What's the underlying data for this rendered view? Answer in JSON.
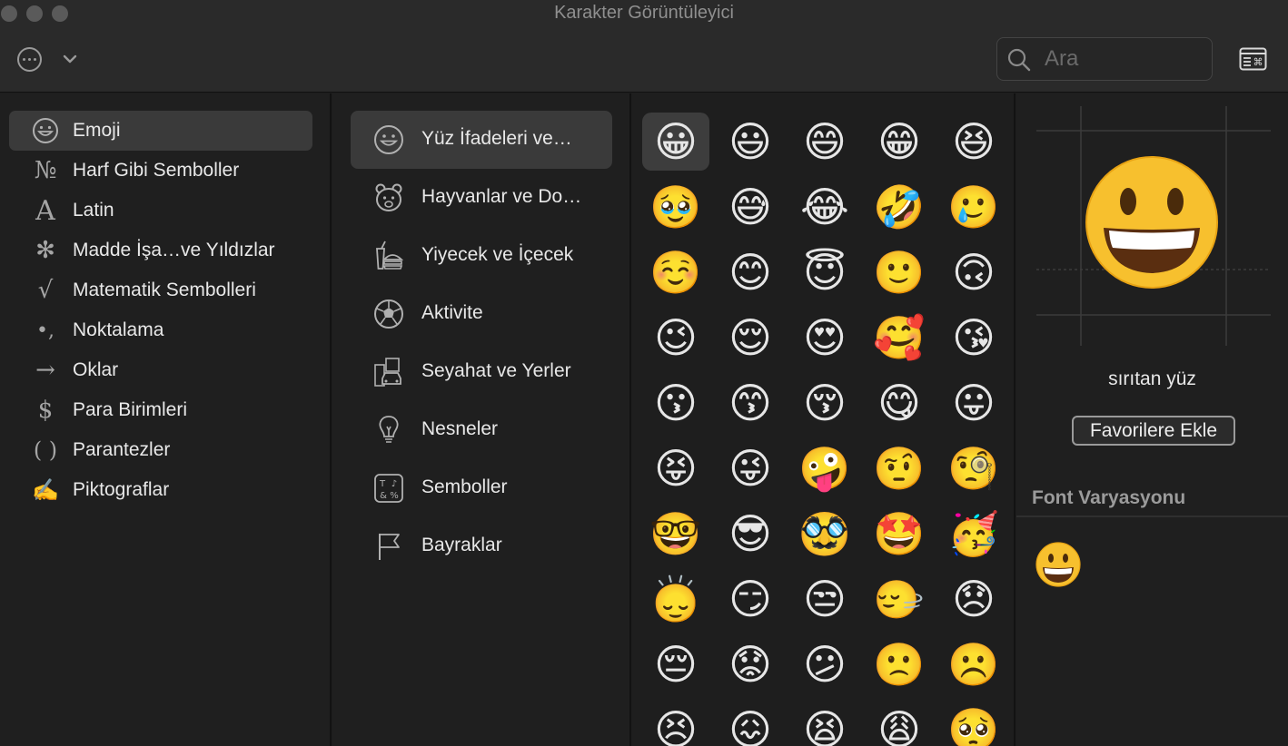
{
  "window": {
    "title": "Karakter Görüntüleyici"
  },
  "toolbar": {
    "search_placeholder": "Ara"
  },
  "categories": [
    {
      "label": "Emoji",
      "icon": "☺"
    },
    {
      "label": "Harf Gibi Semboller",
      "icon": "№"
    },
    {
      "label": "Latin",
      "icon": "A"
    },
    {
      "label": "Madde İşa…ve Yıldızlar",
      "icon": "✻"
    },
    {
      "label": "Matematik Sembolleri",
      "icon": "√"
    },
    {
      "label": "Noktalama",
      "icon": "•,"
    },
    {
      "label": "Oklar",
      "icon": "→"
    },
    {
      "label": "Para Birimleri",
      "icon": "$"
    },
    {
      "label": "Parantezler",
      "icon": "( )"
    },
    {
      "label": "Piktograflar",
      "icon": "✍"
    }
  ],
  "subcategories": [
    {
      "label": "Yüz İfadeleri ve…"
    },
    {
      "label": "Hayvanlar ve Do…"
    },
    {
      "label": "Yiyecek ve İçecek"
    },
    {
      "label": "Aktivite"
    },
    {
      "label": "Seyahat ve Yerler"
    },
    {
      "label": "Nesneler"
    },
    {
      "label": "Semboller"
    },
    {
      "label": "Bayraklar"
    }
  ],
  "emoji_grid": {
    "rows": [
      [
        "😀",
        "😃",
        "😄",
        "😁",
        "😆"
      ],
      [
        "🥹",
        "😅",
        "😂",
        "🤣",
        "🥲"
      ],
      [
        "☺️",
        "😊",
        "😇",
        "🙂",
        "🙃"
      ],
      [
        "😉",
        "😌",
        "😍",
        "🥰",
        "😘"
      ],
      [
        "😗",
        "😙",
        "😚",
        "😋",
        "😛"
      ],
      [
        "😝",
        "😜",
        "🤪",
        "🤨",
        "🧐"
      ],
      [
        "🤓",
        "😎",
        "🥸",
        "🤩",
        "🥳"
      ],
      [
        "🙂‍↕️",
        "😏",
        "😒",
        "🙂‍↔️",
        "😞"
      ],
      [
        "😔",
        "😟",
        "😕",
        "🙁",
        "☹️"
      ],
      [
        "😣",
        "😖",
        "😫",
        "😩",
        "🥺"
      ]
    ]
  },
  "detail": {
    "name": "sırıtan yüz",
    "add_favorite": "Favorilere Ekle",
    "font_variation_title": "Font Varyasyonu"
  }
}
